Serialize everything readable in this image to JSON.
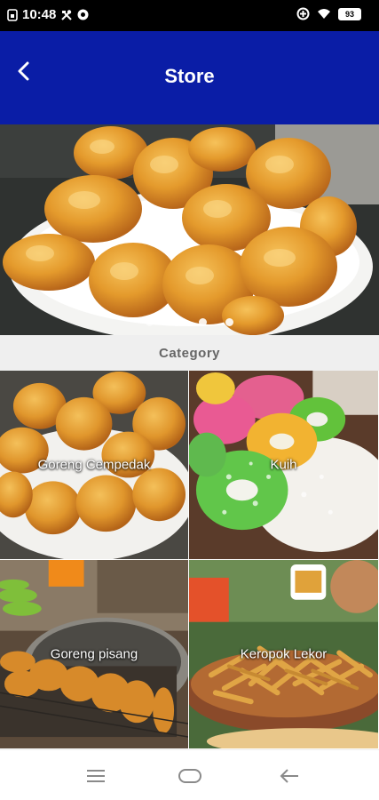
{
  "status_bar": {
    "time": "10:48",
    "left_icons": [
      "sim-icon",
      "tools-icon",
      "vpn-icon"
    ],
    "right_icons": [
      "data-saver-icon",
      "wifi-icon"
    ],
    "battery": "93"
  },
  "header": {
    "title": "Store",
    "back_icon": "chevron-left-icon",
    "background": "#0a1da6"
  },
  "banner": {
    "slide_count": 4,
    "active_index": 0
  },
  "category": {
    "heading": "Category",
    "items": [
      {
        "label": "Goreng Cempedak"
      },
      {
        "label": "Kuih"
      },
      {
        "label": "Goreng pisang"
      },
      {
        "label": "Keropok Lekor"
      }
    ]
  },
  "nav_bar": {
    "icons": [
      "menu-icon",
      "home-icon",
      "back-arrow-icon"
    ]
  }
}
